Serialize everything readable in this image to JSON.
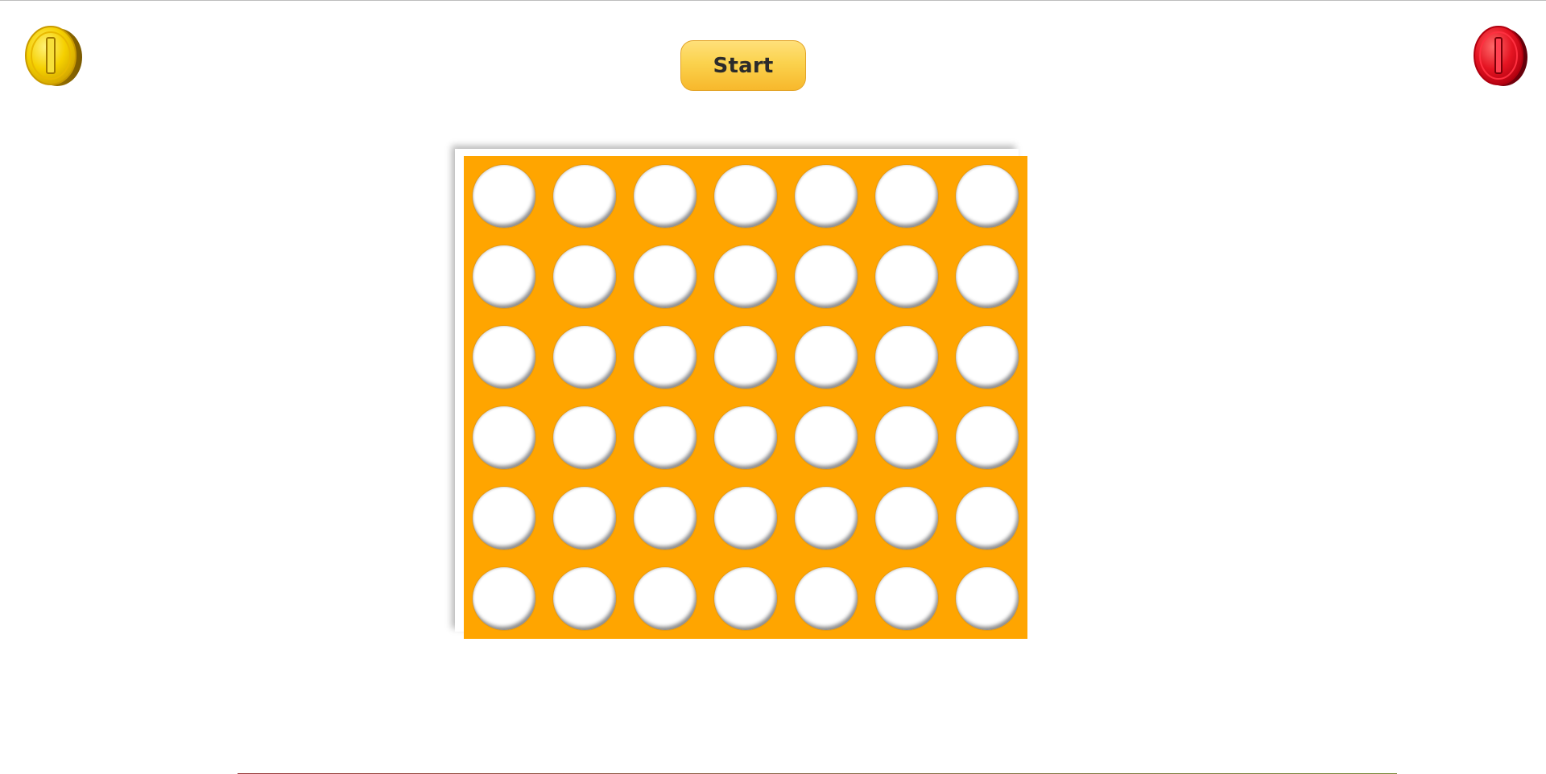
{
  "header": {
    "start_label": "Start"
  },
  "players": [
    {
      "icon": "yellow-coin-icon",
      "color": "#f2cc00"
    },
    {
      "icon": "red-coin-icon",
      "color": "#e0141e"
    }
  ],
  "board": {
    "columns": 7,
    "rows": 6,
    "color": "#ffa500",
    "cells": [
      [
        "empty",
        "empty",
        "empty",
        "empty",
        "empty",
        "empty",
        "empty"
      ],
      [
        "empty",
        "empty",
        "empty",
        "empty",
        "empty",
        "empty",
        "empty"
      ],
      [
        "empty",
        "empty",
        "empty",
        "empty",
        "empty",
        "empty",
        "empty"
      ],
      [
        "empty",
        "empty",
        "empty",
        "empty",
        "empty",
        "empty",
        "empty"
      ],
      [
        "empty",
        "empty",
        "empty",
        "empty",
        "empty",
        "empty",
        "empty"
      ],
      [
        "empty",
        "empty",
        "empty",
        "empty",
        "empty",
        "empty",
        "empty"
      ]
    ]
  }
}
